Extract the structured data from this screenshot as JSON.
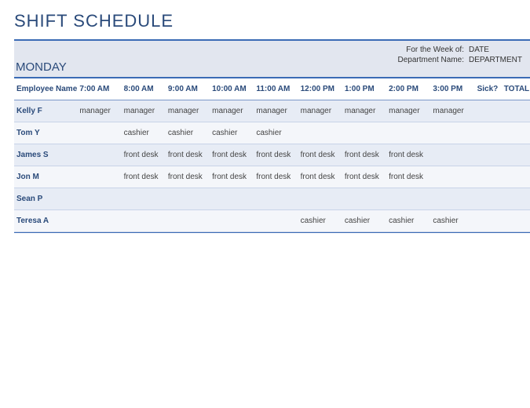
{
  "title": "SHIFT SCHEDULE",
  "day": "MONDAY",
  "meta": {
    "week_label": "For the Week of:",
    "week_value": "DATE",
    "dept_label": "Department Name:",
    "dept_value": "DEPARTMENT"
  },
  "columns": [
    "Employee Name",
    "7:00 AM",
    "8:00 AM",
    "9:00 AM",
    "10:00 AM",
    "11:00 AM",
    "12:00 PM",
    "1:00 PM",
    "2:00 PM",
    "3:00 PM",
    "Sick?",
    "TOTAL"
  ],
  "rows": [
    {
      "name": "Kelly F",
      "cells": [
        "manager",
        "manager",
        "manager",
        "manager",
        "manager",
        "manager",
        "manager",
        "manager",
        "manager",
        "",
        ""
      ]
    },
    {
      "name": "Tom Y",
      "cells": [
        "",
        "cashier",
        "cashier",
        "cashier",
        "cashier",
        "",
        "",
        "",
        "",
        "",
        ""
      ]
    },
    {
      "name": "James S",
      "cells": [
        "",
        "front desk",
        "front desk",
        "front desk",
        "front desk",
        "front desk",
        "front desk",
        "front desk",
        "",
        "",
        ""
      ]
    },
    {
      "name": "Jon M",
      "cells": [
        "",
        "front desk",
        "front desk",
        "front desk",
        "front desk",
        "front desk",
        "front desk",
        "front desk",
        "",
        "",
        ""
      ]
    },
    {
      "name": "Sean P",
      "cells": [
        "",
        "",
        "",
        "",
        "",
        "",
        "",
        "",
        "",
        "",
        ""
      ]
    },
    {
      "name": "Teresa A",
      "cells": [
        "",
        "",
        "",
        "",
        "",
        "cashier",
        "cashier",
        "cashier",
        "cashier",
        "",
        ""
      ]
    }
  ]
}
